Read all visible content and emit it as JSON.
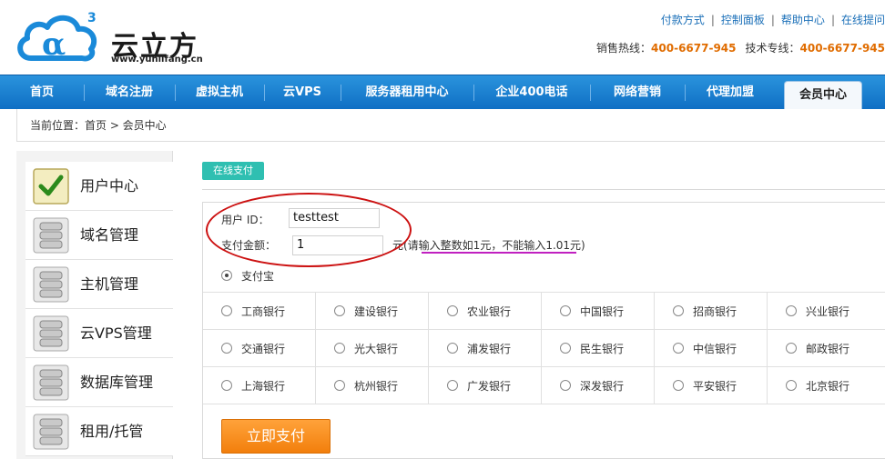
{
  "brand": {
    "name_cn": "云立方",
    "domain": "www.yunlifang.cn",
    "logo_letter": "α",
    "logo_superscript": "3",
    "colors": {
      "blue": "#1a8ad9",
      "orange": "#e06c00"
    }
  },
  "top_links": [
    "付款方式",
    "控制面板",
    "帮助中心",
    "在线提问"
  ],
  "hotline": {
    "sales_label": "销售热线：",
    "sales_number": "400-6677-945",
    "tech_label": "技术专线：",
    "tech_number": "400-6677-945"
  },
  "nav": {
    "items": [
      "首页",
      "域名注册",
      "虚拟主机",
      "云VPS",
      "服务器租用中心",
      "企业400电话",
      "网络营销",
      "代理加盟",
      "会员中心"
    ],
    "active": "会员中心"
  },
  "breadcrumb": "当前位置：首页 > 会员中心",
  "sidebar": {
    "items": [
      {
        "label": "用户中心",
        "icon": "check-icon"
      },
      {
        "label": "域名管理",
        "icon": "server-icon"
      },
      {
        "label": "主机管理",
        "icon": "server-icon"
      },
      {
        "label": "云VPS管理",
        "icon": "server-icon"
      },
      {
        "label": "数据库管理",
        "icon": "server-icon"
      },
      {
        "label": "租用/托管",
        "icon": "server-icon"
      }
    ]
  },
  "payment": {
    "tab_label": "在线支付",
    "user_id_label": "用户 ID：",
    "user_id_value": "testtest",
    "amount_label": "支付金额：",
    "amount_value": "1",
    "amount_hint": "元(请输入整数如1元，不能输入1.01元)",
    "alipay_label": "支付宝",
    "alipay_selected": true,
    "banks": [
      [
        "工商银行",
        "建设银行",
        "农业银行",
        "中国银行",
        "招商银行",
        "兴业银行"
      ],
      [
        "交通银行",
        "光大银行",
        "浦发银行",
        "民生银行",
        "中信银行",
        "邮政银行"
      ],
      [
        "上海银行",
        "杭州银行",
        "广发银行",
        "深发银行",
        "平安银行",
        "北京银行"
      ]
    ],
    "submit_label": "立即支付"
  }
}
